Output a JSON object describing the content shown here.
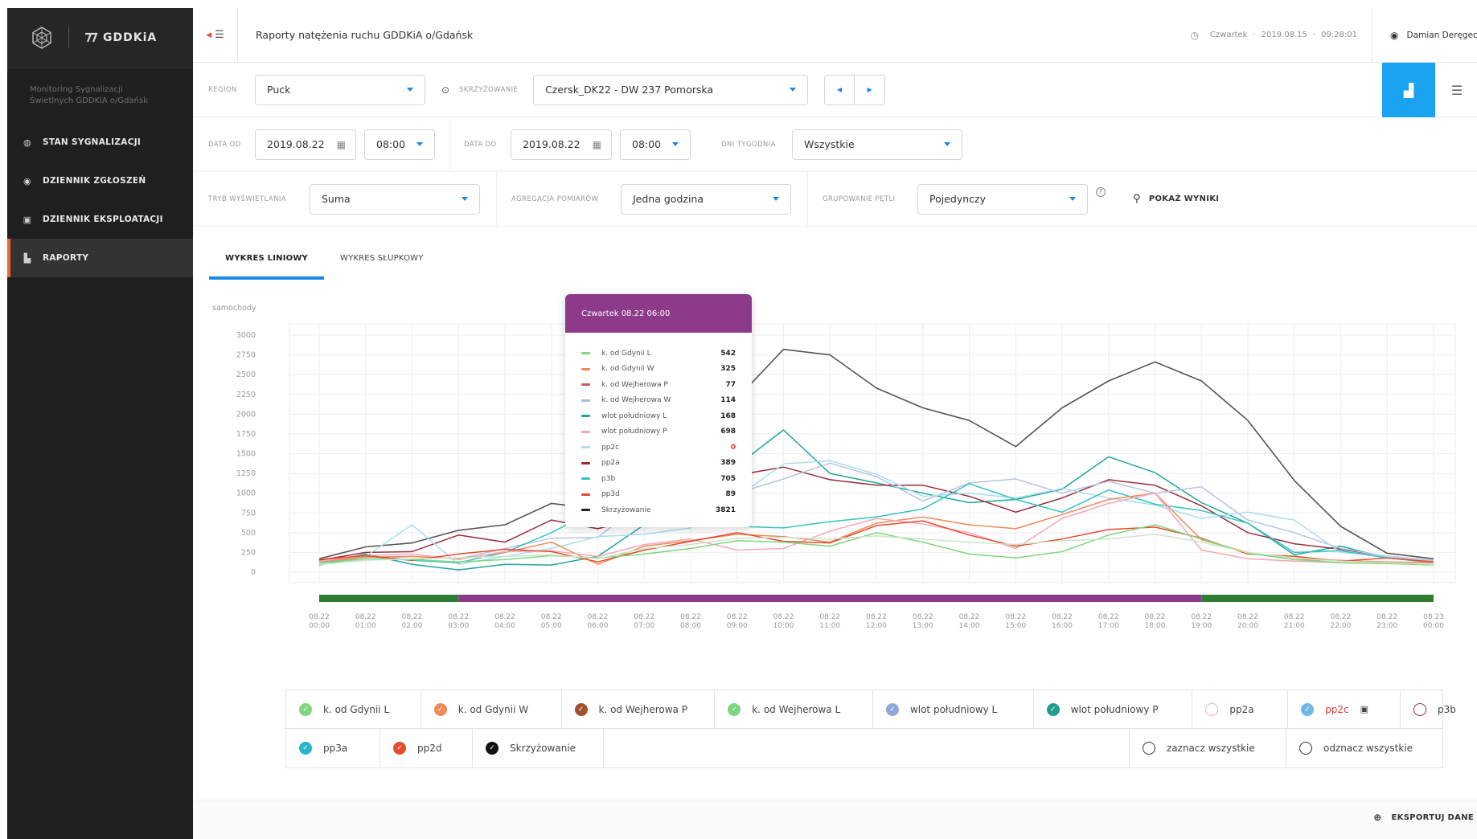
{
  "sidebar": {
    "brand": "GDDKiA",
    "subtitle_line1": "Monitoring Sygnalizacji",
    "subtitle_line2": "Świetlnych GDDKiA o/Gdańsk",
    "items": [
      {
        "label": "STAN SYGNALIZACJI",
        "icon": "gauge-icon",
        "active": false
      },
      {
        "label": "DZIENNIK ZGŁOSZEŃ",
        "icon": "alert-icon",
        "active": false
      },
      {
        "label": "DZIENNIK EKSPLOATACJI",
        "icon": "calendar-icon",
        "active": false
      },
      {
        "label": "RAPORTY",
        "icon": "bar-chart-icon",
        "active": true
      }
    ],
    "accent": "#f0672b"
  },
  "header": {
    "title": "Raporty natężenia ruchu GDDKiA o/Gdańsk",
    "datetime_prefix": "Czwartek",
    "date": "2019.08.15",
    "time": "09:28:01",
    "user": "Damian Deręgecki"
  },
  "filters": {
    "region_label": "REGION",
    "region_value": "Puck",
    "intersection_label": "SKRZYŻOWANIE",
    "intersection_value": "Czersk_DK22 - DW 237 Pomorska",
    "date_from_label": "DATA OD",
    "date_from": "2019.08.22",
    "time_from": "08:00",
    "date_to_label": "DATA DO",
    "date_to": "2019.08.22",
    "time_to": "08:00",
    "weekdays_label": "DNI TYGODNIA",
    "weekdays_value": "Wszystkie",
    "display_mode_label": "TRYB WYŚWIETLANIA",
    "display_mode_value": "Suma",
    "aggregation_label": "AGREGACJA POMIARÓW",
    "aggregation_value": "Jedna godzina",
    "loop_grouping_label": "GRUPOWANIE PĘTLI",
    "loop_grouping_value": "Pojedynczy",
    "show_results": "POKAŻ WYNIKI"
  },
  "tabs": [
    {
      "label": "WYKRES LINIOWY",
      "active": true
    },
    {
      "label": "WYKRES SŁUPKOWY",
      "active": false
    }
  ],
  "tooltip": {
    "title": "Czwartek 08.22 06:00",
    "rows": [
      {
        "name": "k. od Gdynii L",
        "value": "542",
        "color": "#7ed67e"
      },
      {
        "name": "k. od Gdynii W",
        "value": "325",
        "color": "#f08a5d"
      },
      {
        "name": "k. od Wejherowa P",
        "value": "77",
        "color": "#c0605a"
      },
      {
        "name": "k. od Wejherowa W",
        "value": "114",
        "color": "#a9b9e0"
      },
      {
        "name": "wlot południowy L",
        "value": "168",
        "color": "#1fa79a"
      },
      {
        "name": "wlot południowy P",
        "value": "698",
        "color": "#f4a9b5"
      },
      {
        "name": "pp2c",
        "value": "0",
        "color": "#a8dff0",
        "value_color": "#e53935"
      },
      {
        "name": "pp2a",
        "value": "389",
        "color": "#9b2d3b"
      },
      {
        "name": "p3b",
        "value": "705",
        "color": "#34c4c4"
      },
      {
        "name": "pp3d",
        "value": "89",
        "color": "#e84a2e"
      },
      {
        "name": "Skrzyżowanie",
        "value": "3821",
        "color": "#222222"
      }
    ]
  },
  "legend": {
    "row1": [
      {
        "label": "k. od Gdynii L",
        "color": "#7ed67e",
        "checked": true
      },
      {
        "label": "k. od Gdynii W",
        "color": "#f08a5d",
        "checked": true
      },
      {
        "label": "k. od Wejherowa P",
        "color": "#a0522d",
        "checked": true
      },
      {
        "label": "k. od Wejherowa L",
        "color": "#7ed67e",
        "checked": true
      },
      {
        "label": "wlot południowy L",
        "color": "#8fa8d8",
        "checked": true
      },
      {
        "label": "wlot południowy P",
        "color": "#1f9e8f",
        "checked": true
      },
      {
        "label": "pp2a",
        "color": "#f4a9b5",
        "checked": false
      },
      {
        "label": "pp2c",
        "color": "#6fb8e6",
        "checked": true,
        "label_color": "#e53935"
      },
      {
        "label": "p3b",
        "color": "#9b2d3b",
        "checked": false
      }
    ],
    "row2": [
      {
        "label": "pp3a",
        "color": "#26b5c9",
        "checked": true
      },
      {
        "label": "pp2d",
        "color": "#e84a2e",
        "checked": true
      },
      {
        "label": "Skrzyżowanie",
        "color": "#111111",
        "checked": true
      }
    ],
    "select_all": "zaznacz wszystkie",
    "deselect_all": "odznacz wszystkie"
  },
  "export_label": "EKSPORTUJ DANE",
  "chart_data": {
    "type": "line",
    "ylabel": "samochody",
    "ylim": [
      0,
      3000
    ],
    "yticks": [
      0,
      250,
      500,
      750,
      1000,
      1250,
      1500,
      1750,
      2000,
      2250,
      2500,
      2750,
      3000
    ],
    "x": [
      "08.22 00:00",
      "08.22 01:00",
      "08.22 02:00",
      "08.22 03:00",
      "08.22 04:00",
      "08.22 05:00",
      "08.22 06:00",
      "08.22 07:00",
      "08.22 08:00",
      "08.22 09:00",
      "08.22 10:00",
      "08.22 11:00",
      "08.22 12:00",
      "08.22 13:00",
      "08.22 14:00",
      "08.22 15:00",
      "08.22 16:00",
      "08.22 17:00",
      "08.22 18:00",
      "08.22 19:00",
      "08.22 20:00",
      "08.22 21:00",
      "08.22 22:00",
      "08.22 23:00",
      "08.23 00:00"
    ],
    "series": [
      {
        "name": "Skrzyżowanie",
        "color": "#555555",
        "values": [
          170,
          320,
          370,
          530,
          600,
          870,
          800,
          1150,
          1600,
          2200,
          2820,
          2750,
          2330,
          2080,
          1920,
          1590,
          2080,
          2420,
          2660,
          2420,
          1920,
          1160,
          580,
          240,
          170
        ]
      },
      {
        "name": "wlot południowy P",
        "color": "#1fa79a",
        "values": [
          100,
          230,
          100,
          30,
          100,
          90,
          200,
          600,
          1150,
          1350,
          1800,
          1250,
          1130,
          1000,
          880,
          920,
          1050,
          1460,
          1260,
          880,
          620,
          220,
          330,
          180,
          130
        ]
      },
      {
        "name": "pp2a",
        "color": "#9b2d3b",
        "values": [
          150,
          250,
          260,
          470,
          380,
          660,
          550,
          700,
          900,
          1230,
          1330,
          1170,
          1100,
          1100,
          960,
          760,
          940,
          1170,
          1100,
          840,
          500,
          360,
          290,
          200,
          150
        ]
      },
      {
        "name": "k. od Wejherowa W",
        "color": "#b7c3e3",
        "values": [
          120,
          150,
          200,
          170,
          300,
          430,
          440,
          900,
          650,
          1000,
          1180,
          1380,
          1210,
          900,
          1130,
          1180,
          1000,
          1150,
          1000,
          1080,
          660,
          500,
          300,
          200,
          150
        ]
      },
      {
        "name": "pp2c",
        "color": "#a8dff0",
        "values": [
          110,
          200,
          600,
          100,
          200,
          300,
          450,
          480,
          560,
          950,
          1370,
          1410,
          1240,
          960,
          1000,
          940,
          1060,
          940,
          850,
          680,
          760,
          660,
          250,
          200,
          130
        ]
      },
      {
        "name": "p3b",
        "color": "#34c4c4",
        "values": [
          90,
          200,
          150,
          120,
          250,
          500,
          800,
          900,
          660,
          580,
          560,
          640,
          700,
          800,
          1120,
          920,
          760,
          1040,
          860,
          780,
          620,
          250,
          270,
          180,
          120
        ]
      },
      {
        "name": "k. od Gdynii W",
        "color": "#f08a5d",
        "values": [
          130,
          190,
          200,
          170,
          250,
          380,
          100,
          330,
          400,
          480,
          450,
          380,
          620,
          700,
          600,
          550,
          730,
          920,
          1000,
          410,
          250,
          160,
          150,
          130,
          120
        ]
      },
      {
        "name": "wlot południowy L",
        "color": "#f4a9b5",
        "values": [
          140,
          210,
          230,
          160,
          260,
          270,
          200,
          350,
          420,
          280,
          300,
          520,
          680,
          610,
          500,
          300,
          680,
          870,
          1000,
          280,
          170,
          140,
          120,
          110,
          100
        ]
      },
      {
        "name": "pp3d",
        "color": "#e84a2e",
        "values": [
          160,
          210,
          150,
          230,
          290,
          260,
          130,
          280,
          390,
          500,
          390,
          370,
          590,
          650,
          470,
          330,
          420,
          540,
          570,
          430,
          230,
          200,
          140,
          180,
          130
        ]
      },
      {
        "name": "k. od Gdynii L",
        "color": "#7ed67e",
        "values": [
          120,
          170,
          160,
          130,
          160,
          210,
          180,
          230,
          300,
          400,
          380,
          330,
          500,
          380,
          230,
          180,
          260,
          470,
          600,
          420,
          240,
          160,
          120,
          110,
          90
        ]
      },
      {
        "name": "k. od Wejherowa L",
        "color": "#c9e6c9",
        "values": [
          100,
          150,
          170,
          180,
          200,
          220,
          170,
          300,
          350,
          430,
          440,
          420,
          460,
          420,
          380,
          350,
          400,
          420,
          480,
          380,
          250,
          180,
          140,
          120,
          100
        ]
      }
    ],
    "phase_bar": [
      {
        "from": 0,
        "to": 3,
        "color": "#2e7d32"
      },
      {
        "from": 3,
        "to": 19,
        "color": "#8e3a8b"
      },
      {
        "from": 19,
        "to": 24,
        "color": "#2e7d32"
      }
    ]
  }
}
